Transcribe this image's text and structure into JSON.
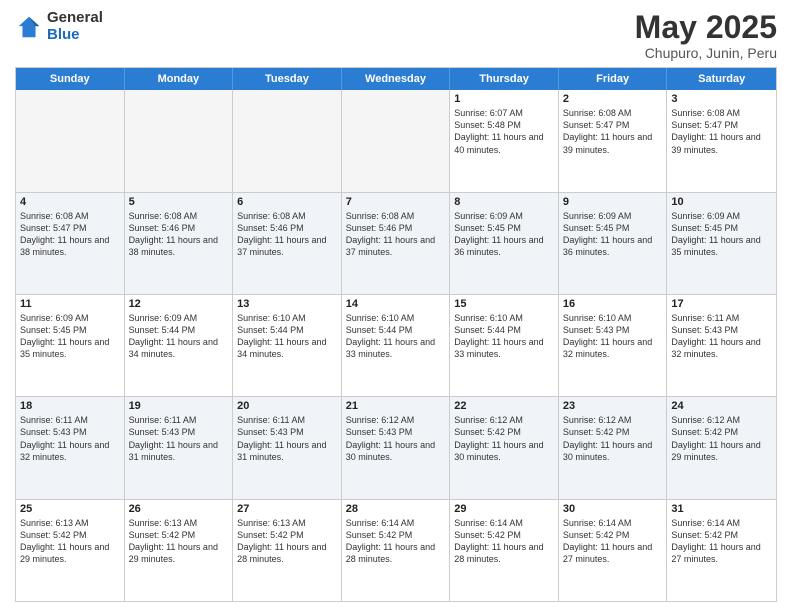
{
  "logo": {
    "general": "General",
    "blue": "Blue"
  },
  "title": {
    "month_year": "May 2025",
    "location": "Chupuro, Junin, Peru"
  },
  "header_days": [
    "Sunday",
    "Monday",
    "Tuesday",
    "Wednesday",
    "Thursday",
    "Friday",
    "Saturday"
  ],
  "weeks": [
    [
      {
        "day": "",
        "sunrise": "",
        "sunset": "",
        "daylight": "",
        "empty": true
      },
      {
        "day": "",
        "sunrise": "",
        "sunset": "",
        "daylight": "",
        "empty": true
      },
      {
        "day": "",
        "sunrise": "",
        "sunset": "",
        "daylight": "",
        "empty": true
      },
      {
        "day": "",
        "sunrise": "",
        "sunset": "",
        "daylight": "",
        "empty": true
      },
      {
        "day": "1",
        "sunrise": "Sunrise: 6:07 AM",
        "sunset": "Sunset: 5:48 PM",
        "daylight": "Daylight: 11 hours and 40 minutes."
      },
      {
        "day": "2",
        "sunrise": "Sunrise: 6:08 AM",
        "sunset": "Sunset: 5:47 PM",
        "daylight": "Daylight: 11 hours and 39 minutes."
      },
      {
        "day": "3",
        "sunrise": "Sunrise: 6:08 AM",
        "sunset": "Sunset: 5:47 PM",
        "daylight": "Daylight: 11 hours and 39 minutes."
      }
    ],
    [
      {
        "day": "4",
        "sunrise": "Sunrise: 6:08 AM",
        "sunset": "Sunset: 5:47 PM",
        "daylight": "Daylight: 11 hours and 38 minutes."
      },
      {
        "day": "5",
        "sunrise": "Sunrise: 6:08 AM",
        "sunset": "Sunset: 5:46 PM",
        "daylight": "Daylight: 11 hours and 38 minutes."
      },
      {
        "day": "6",
        "sunrise": "Sunrise: 6:08 AM",
        "sunset": "Sunset: 5:46 PM",
        "daylight": "Daylight: 11 hours and 37 minutes."
      },
      {
        "day": "7",
        "sunrise": "Sunrise: 6:08 AM",
        "sunset": "Sunset: 5:46 PM",
        "daylight": "Daylight: 11 hours and 37 minutes."
      },
      {
        "day": "8",
        "sunrise": "Sunrise: 6:09 AM",
        "sunset": "Sunset: 5:45 PM",
        "daylight": "Daylight: 11 hours and 36 minutes."
      },
      {
        "day": "9",
        "sunrise": "Sunrise: 6:09 AM",
        "sunset": "Sunset: 5:45 PM",
        "daylight": "Daylight: 11 hours and 36 minutes."
      },
      {
        "day": "10",
        "sunrise": "Sunrise: 6:09 AM",
        "sunset": "Sunset: 5:45 PM",
        "daylight": "Daylight: 11 hours and 35 minutes."
      }
    ],
    [
      {
        "day": "11",
        "sunrise": "Sunrise: 6:09 AM",
        "sunset": "Sunset: 5:45 PM",
        "daylight": "Daylight: 11 hours and 35 minutes."
      },
      {
        "day": "12",
        "sunrise": "Sunrise: 6:09 AM",
        "sunset": "Sunset: 5:44 PM",
        "daylight": "Daylight: 11 hours and 34 minutes."
      },
      {
        "day": "13",
        "sunrise": "Sunrise: 6:10 AM",
        "sunset": "Sunset: 5:44 PM",
        "daylight": "Daylight: 11 hours and 34 minutes."
      },
      {
        "day": "14",
        "sunrise": "Sunrise: 6:10 AM",
        "sunset": "Sunset: 5:44 PM",
        "daylight": "Daylight: 11 hours and 33 minutes."
      },
      {
        "day": "15",
        "sunrise": "Sunrise: 6:10 AM",
        "sunset": "Sunset: 5:44 PM",
        "daylight": "Daylight: 11 hours and 33 minutes."
      },
      {
        "day": "16",
        "sunrise": "Sunrise: 6:10 AM",
        "sunset": "Sunset: 5:43 PM",
        "daylight": "Daylight: 11 hours and 32 minutes."
      },
      {
        "day": "17",
        "sunrise": "Sunrise: 6:11 AM",
        "sunset": "Sunset: 5:43 PM",
        "daylight": "Daylight: 11 hours and 32 minutes."
      }
    ],
    [
      {
        "day": "18",
        "sunrise": "Sunrise: 6:11 AM",
        "sunset": "Sunset: 5:43 PM",
        "daylight": "Daylight: 11 hours and 32 minutes."
      },
      {
        "day": "19",
        "sunrise": "Sunrise: 6:11 AM",
        "sunset": "Sunset: 5:43 PM",
        "daylight": "Daylight: 11 hours and 31 minutes."
      },
      {
        "day": "20",
        "sunrise": "Sunrise: 6:11 AM",
        "sunset": "Sunset: 5:43 PM",
        "daylight": "Daylight: 11 hours and 31 minutes."
      },
      {
        "day": "21",
        "sunrise": "Sunrise: 6:12 AM",
        "sunset": "Sunset: 5:43 PM",
        "daylight": "Daylight: 11 hours and 30 minutes."
      },
      {
        "day": "22",
        "sunrise": "Sunrise: 6:12 AM",
        "sunset": "Sunset: 5:42 PM",
        "daylight": "Daylight: 11 hours and 30 minutes."
      },
      {
        "day": "23",
        "sunrise": "Sunrise: 6:12 AM",
        "sunset": "Sunset: 5:42 PM",
        "daylight": "Daylight: 11 hours and 30 minutes."
      },
      {
        "day": "24",
        "sunrise": "Sunrise: 6:12 AM",
        "sunset": "Sunset: 5:42 PM",
        "daylight": "Daylight: 11 hours and 29 minutes."
      }
    ],
    [
      {
        "day": "25",
        "sunrise": "Sunrise: 6:13 AM",
        "sunset": "Sunset: 5:42 PM",
        "daylight": "Daylight: 11 hours and 29 minutes."
      },
      {
        "day": "26",
        "sunrise": "Sunrise: 6:13 AM",
        "sunset": "Sunset: 5:42 PM",
        "daylight": "Daylight: 11 hours and 29 minutes."
      },
      {
        "day": "27",
        "sunrise": "Sunrise: 6:13 AM",
        "sunset": "Sunset: 5:42 PM",
        "daylight": "Daylight: 11 hours and 28 minutes."
      },
      {
        "day": "28",
        "sunrise": "Sunrise: 6:14 AM",
        "sunset": "Sunset: 5:42 PM",
        "daylight": "Daylight: 11 hours and 28 minutes."
      },
      {
        "day": "29",
        "sunrise": "Sunrise: 6:14 AM",
        "sunset": "Sunset: 5:42 PM",
        "daylight": "Daylight: 11 hours and 28 minutes."
      },
      {
        "day": "30",
        "sunrise": "Sunrise: 6:14 AM",
        "sunset": "Sunset: 5:42 PM",
        "daylight": "Daylight: 11 hours and 27 minutes."
      },
      {
        "day": "31",
        "sunrise": "Sunrise: 6:14 AM",
        "sunset": "Sunset: 5:42 PM",
        "daylight": "Daylight: 11 hours and 27 minutes."
      }
    ]
  ]
}
